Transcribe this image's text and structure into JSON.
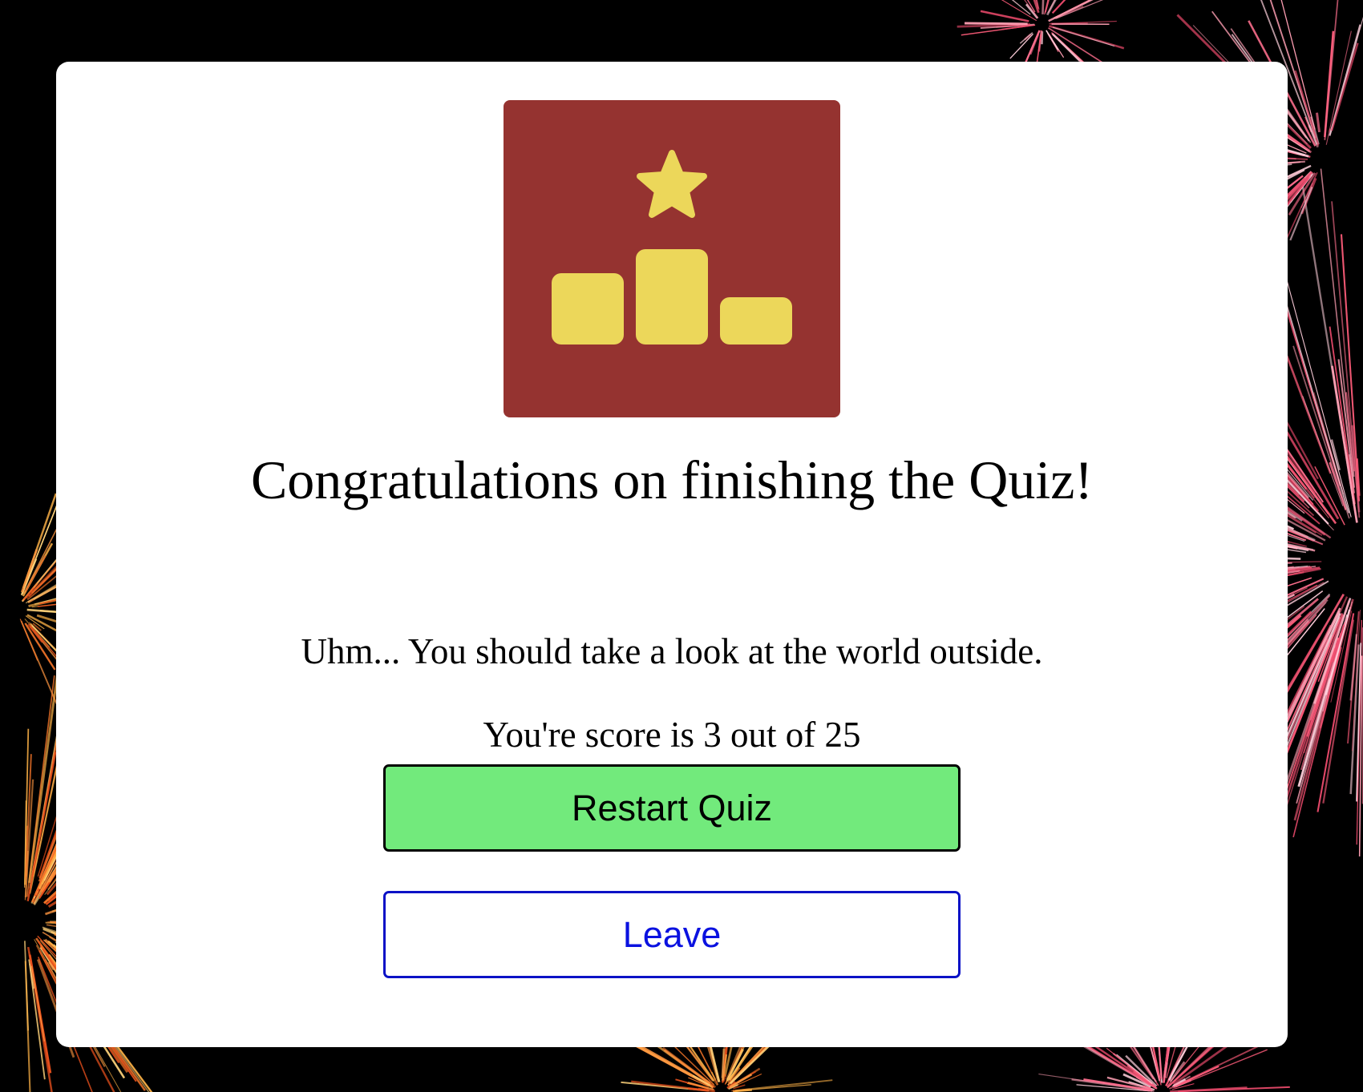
{
  "result": {
    "heading": "Congratulations on finishing the Quiz!",
    "message": "Uhm... You should take a look at the world outside.",
    "score_text": "You're score is 3 out of 25",
    "score": 3,
    "total": 25
  },
  "buttons": {
    "restart_label": "Restart Quiz",
    "leave_label": "Leave"
  },
  "colors": {
    "trophy_bg": "#953330",
    "trophy_icon": "#ecd75a",
    "restart_bg": "#72ea7c",
    "leave_border": "#0b12c6"
  },
  "icons": {
    "trophy": "podium-star-icon",
    "background": "fireworks"
  }
}
